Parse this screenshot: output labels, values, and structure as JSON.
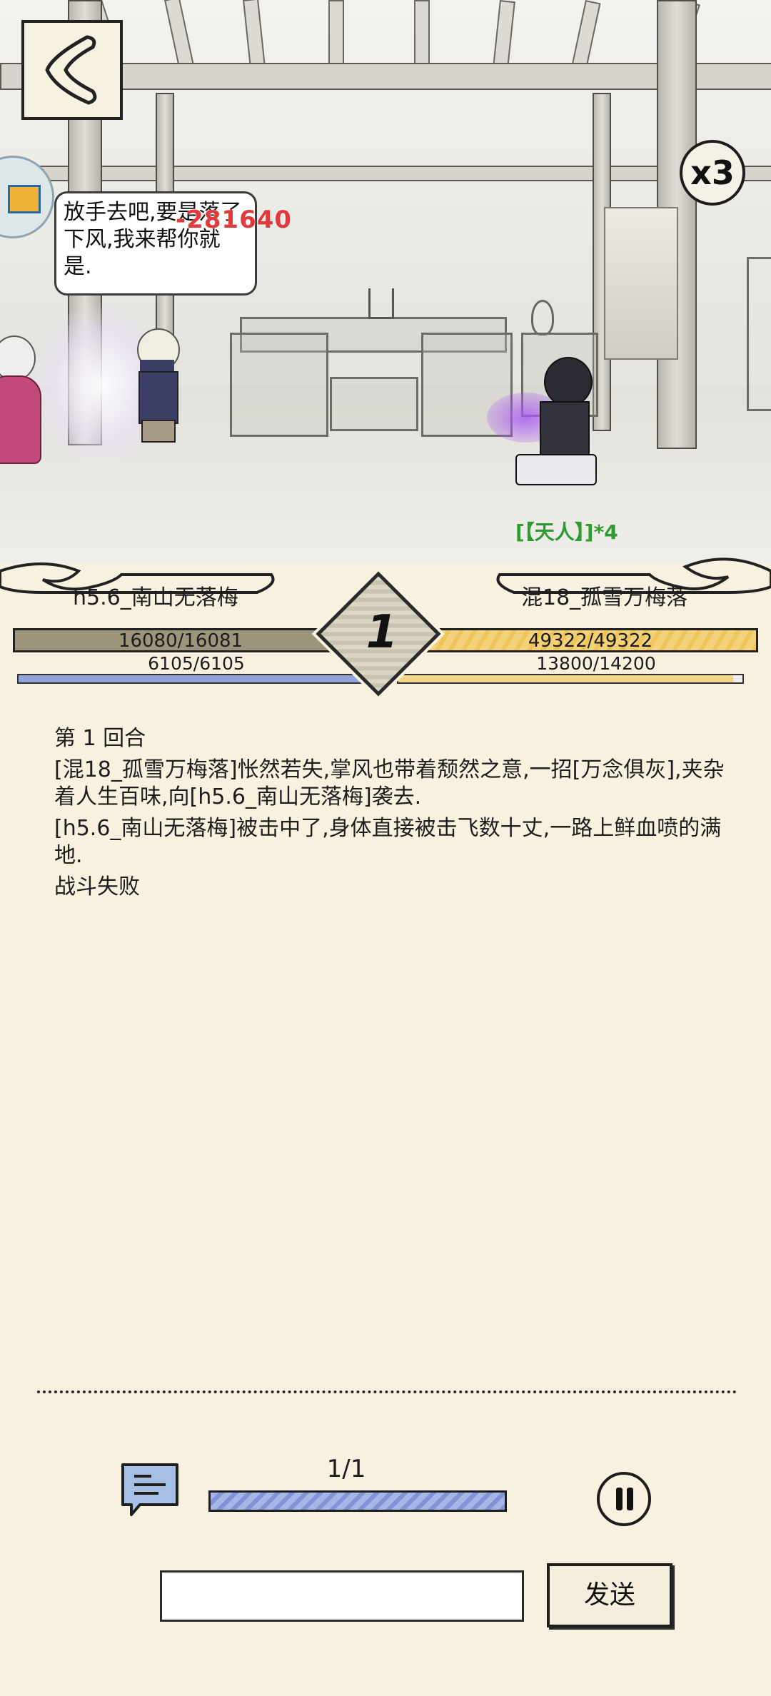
{
  "scene": {
    "speech_text": "放手去吧,要是落了下风,我来帮你就是.",
    "damage_text": "-281640",
    "buff_text": "[【天人】]*4",
    "speed_label": "x3"
  },
  "battle": {
    "round": "1",
    "player": {
      "name": "h5.6_南山无落梅",
      "hp_text": "16080/16081",
      "hp_fraction": 0.9999,
      "mp_text": "6105/6105",
      "mp_fraction": 1.0
    },
    "enemy": {
      "name": "混18_孤雪万梅落",
      "hp_text": "49322/49322",
      "hp_fraction": 1.0,
      "mp_text": "13800/14200",
      "mp_fraction": 0.972
    }
  },
  "log": {
    "round_title": "第 1 回合",
    "lines": [
      "[混18_孤雪万梅落]怅然若失,掌风也带着颓然之意,一招[万念俱灰],夹杂着人生百味,向[h5.6_南山无落梅]袭去.",
      "[h5.6_南山无落梅]被击中了,身体直接被击飞数十丈,一路上鲜血喷的满地.",
      "战斗失败"
    ]
  },
  "controls": {
    "progress_text": "1/1",
    "progress_fraction": 1.0,
    "input_value": "",
    "send_label": "发送"
  },
  "colors": {
    "background": "#f8f1e0",
    "player_hp": "#9c957c",
    "enemy_hp": "#f3cf72",
    "player_mp": "#8fa3d8",
    "enemy_mp": "#f3d58a",
    "damage": "#e23a3a",
    "buff": "#2f9a2f"
  }
}
